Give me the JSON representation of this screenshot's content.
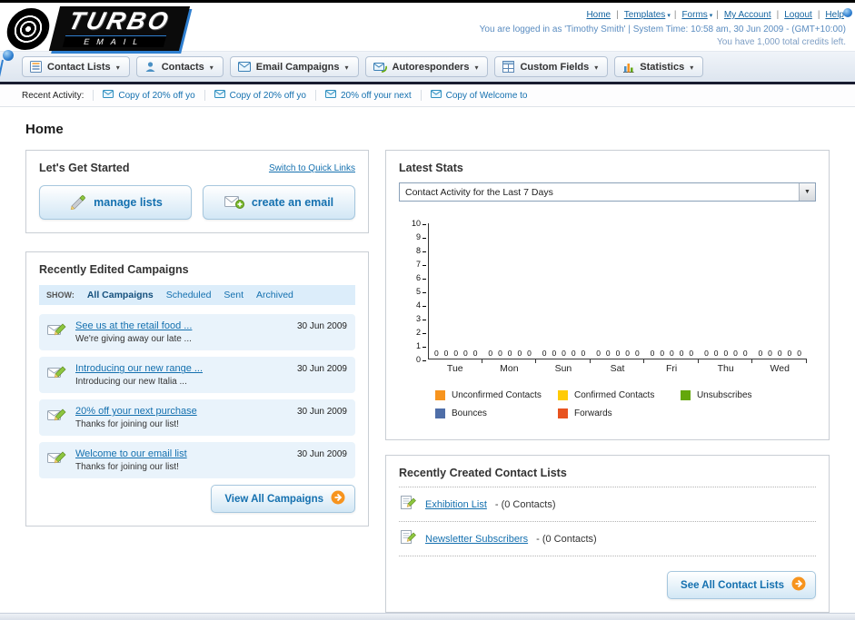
{
  "header": {
    "logo_primary": "TURBO",
    "logo_secondary": "EMAIL",
    "links": [
      "Home",
      "Templates",
      "Forms",
      "My Account",
      "Logout",
      "Help"
    ],
    "session_text": "You are logged in as 'Timothy Smith' | System Time: 10:58 am, 30 Jun 2009 - (GMT+10:00)",
    "credits_text": "You have 1,000 total credits left."
  },
  "nav": {
    "tabs": [
      {
        "label": "Contact Lists",
        "icon": "contact-lists-icon"
      },
      {
        "label": "Contacts",
        "icon": "contacts-icon"
      },
      {
        "label": "Email Campaigns",
        "icon": "email-campaigns-icon"
      },
      {
        "label": "Autoresponders",
        "icon": "autoresponders-icon"
      },
      {
        "label": "Custom Fields",
        "icon": "custom-fields-icon"
      },
      {
        "label": "Statistics",
        "icon": "statistics-icon"
      }
    ]
  },
  "recent_activity": {
    "label": "Recent Activity:",
    "items": [
      "Copy of 20% off yo",
      "Copy of 20% off yo",
      "20% off your next",
      "Copy of Welcome to"
    ]
  },
  "page": {
    "title": "Home"
  },
  "get_started": {
    "title": "Let's Get Started",
    "switch_link": "Switch to Quick Links",
    "manage_lists_button": "manage lists",
    "create_email_button": "create an email"
  },
  "campaigns": {
    "title": "Recently Edited Campaigns",
    "show_label": "SHOW:",
    "filters": [
      "All Campaigns",
      "Scheduled",
      "Sent",
      "Archived"
    ],
    "items": [
      {
        "title": "See us at the retail food ...",
        "subtitle": "We're giving away our late ...",
        "date": "30 Jun 2009"
      },
      {
        "title": "Introducing our new range ...",
        "subtitle": "Introducing our new Italia ...",
        "date": "30 Jun 2009"
      },
      {
        "title": "20% off your next purchase",
        "subtitle": "Thanks for joining our list!",
        "date": "30 Jun 2009"
      },
      {
        "title": "Welcome to our email list",
        "subtitle": "Thanks for joining our list!",
        "date": "30 Jun 2009"
      }
    ],
    "view_all_button": "View All Campaigns"
  },
  "stats": {
    "title": "Latest Stats",
    "period_selected": "Contact Activity for the Last 7 Days"
  },
  "chart_data": {
    "type": "bar",
    "title": "Contact Activity for the Last 7 Days",
    "categories": [
      "Tue",
      "Mon",
      "Sun",
      "Sat",
      "Fri",
      "Thu",
      "Wed"
    ],
    "series": [
      {
        "name": "Unconfirmed Contacts",
        "color": "#f7941e",
        "values": [
          0,
          0,
          0,
          0,
          0,
          0,
          0
        ]
      },
      {
        "name": "Confirmed Contacts",
        "color": "#ffcb05",
        "values": [
          0,
          0,
          0,
          0,
          0,
          0,
          0
        ]
      },
      {
        "name": "Unsubscribes",
        "color": "#64a70b",
        "values": [
          0,
          0,
          0,
          0,
          0,
          0,
          0
        ]
      },
      {
        "name": "Bounces",
        "color": "#4f6ea8",
        "values": [
          0,
          0,
          0,
          0,
          0,
          0,
          0
        ]
      },
      {
        "name": "Forwards",
        "color": "#e8531f",
        "values": [
          0,
          0,
          0,
          0,
          0,
          0,
          0
        ]
      }
    ],
    "ylim": [
      0,
      10
    ],
    "ytick_step": 1,
    "grid": false,
    "legend_position": "bottom"
  },
  "contact_lists": {
    "title": "Recently Created Contact Lists",
    "items": [
      {
        "name": "Exhibition List",
        "count": "- (0 Contacts)"
      },
      {
        "name": "Newsletter Subscribers",
        "count": "- (0 Contacts)"
      }
    ],
    "see_all_button": "See All Contact Lists"
  }
}
